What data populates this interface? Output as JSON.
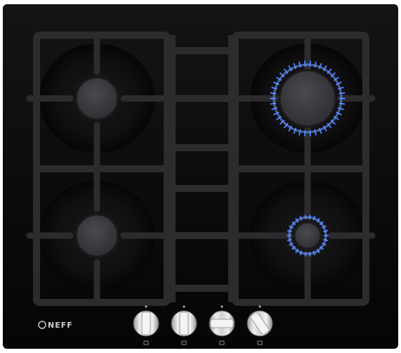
{
  "product": {
    "brand": "NEFF",
    "colors": {
      "glass": "#0b0b0c",
      "grate": "#2b2b2d",
      "burner_cap": "#3a3b3e",
      "flame": "#4a7cff",
      "knob": "#dcdcdc"
    }
  },
  "burners": [
    {
      "name": "rear-left-burner",
      "lit": false
    },
    {
      "name": "rear-right-burner",
      "lit": true
    },
    {
      "name": "front-left-burner",
      "lit": false
    },
    {
      "name": "front-right-burner",
      "lit": true
    }
  ],
  "knobs": [
    {
      "name": "knob-1"
    },
    {
      "name": "knob-2"
    },
    {
      "name": "knob-3"
    },
    {
      "name": "knob-4"
    }
  ]
}
